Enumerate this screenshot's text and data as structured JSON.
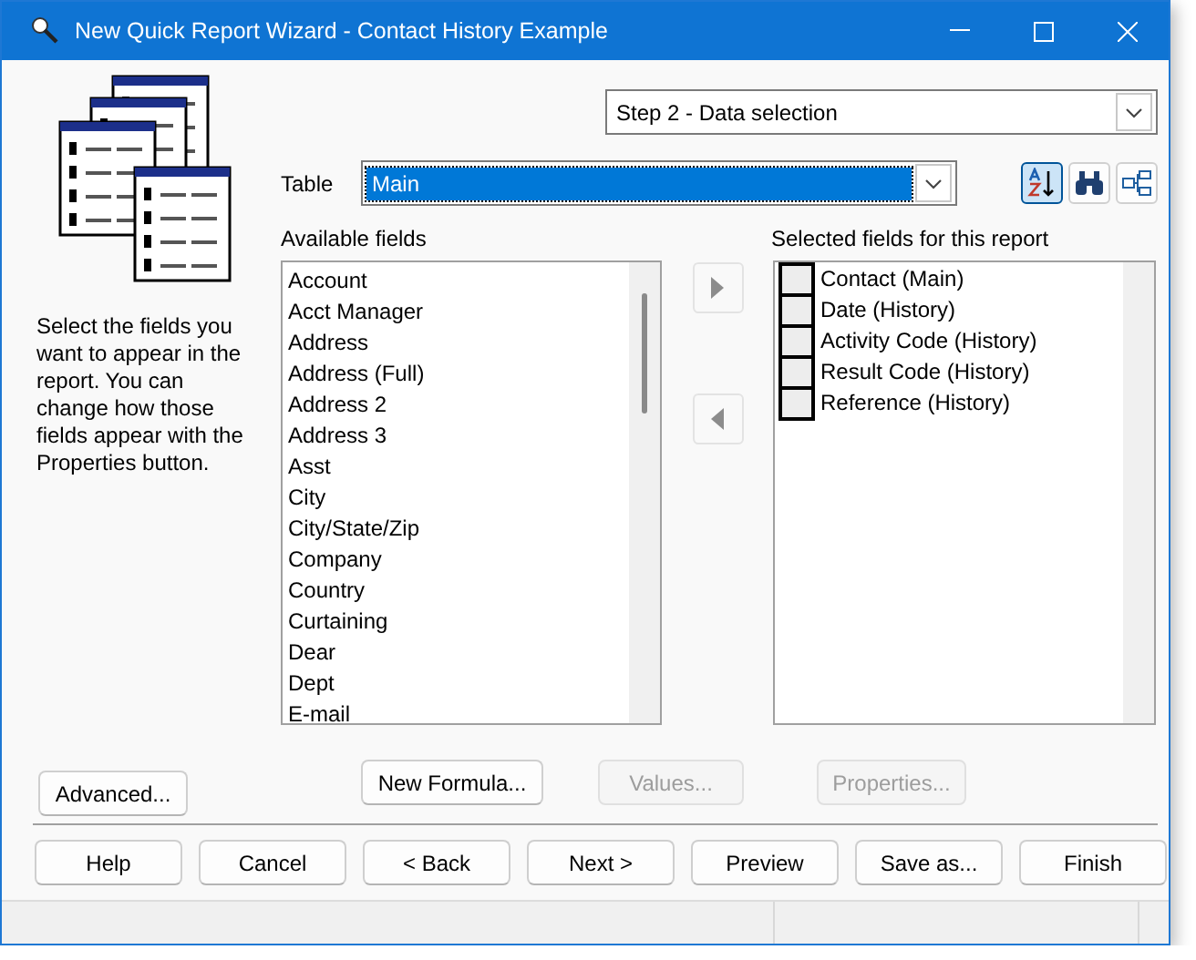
{
  "window": {
    "title": "New Quick Report Wizard - Contact History Example"
  },
  "step_select": {
    "value": "Step 2 - Data selection"
  },
  "table_select": {
    "label": "Table",
    "value": "Main"
  },
  "tools": [
    {
      "kind": "sort",
      "selected": true
    },
    {
      "kind": "find",
      "selected": false
    },
    {
      "kind": "tree",
      "selected": false
    }
  ],
  "description": "Select the fields you want to appear in the report. You can change how those fields appear with the Properties button.",
  "available_fields": {
    "label": "Available fields",
    "items": [
      "Account",
      "Acct Manager",
      "Address",
      "Address (Full)",
      "Address 2",
      "Address 3",
      "Asst",
      "City",
      "City/State/Zip",
      "Company",
      "Country",
      "Curtaining",
      "Dear",
      "Dept",
      "E-mail"
    ]
  },
  "move_buttons": [
    {
      "kind": "add"
    },
    {
      "kind": "remove"
    }
  ],
  "selected_fields": {
    "label": "Selected fields for this report",
    "items": [
      "Contact (Main)",
      "Date (History)",
      "Activity Code (History)",
      "Result Code (History)",
      "Reference (History)"
    ]
  },
  "field_buttons": [
    {
      "label": "Advanced...",
      "disabled": false
    },
    {
      "label": "New Formula...",
      "disabled": false
    },
    {
      "label": "Values...",
      "disabled": true
    },
    {
      "label": "Properties...",
      "disabled": true
    }
  ],
  "nav_buttons": [
    "Help",
    "Cancel",
    "< Back",
    "Next >",
    "Preview",
    "Save as...",
    "Finish"
  ]
}
